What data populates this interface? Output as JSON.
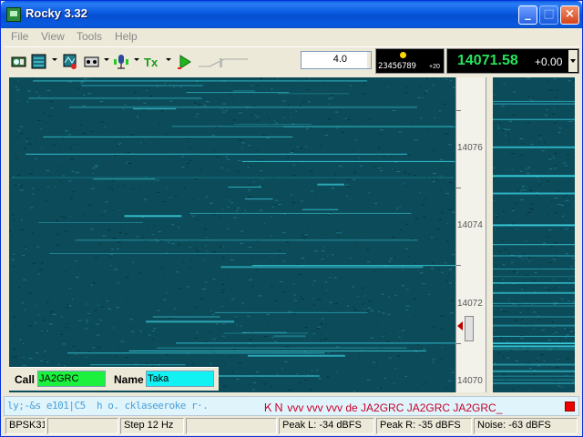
{
  "window": {
    "title": "Rocky 3.32"
  },
  "menu": [
    "File",
    "View",
    "Tools",
    "Help"
  ],
  "toolbar": {
    "zoom_value": "4.0",
    "level_digits": "23456789",
    "level_db": "+20",
    "frequency": "14071.58",
    "offset": "+0.00"
  },
  "scale": {
    "labels": [
      "14076",
      "14074",
      "14072",
      "14070"
    ]
  },
  "call_panel": {
    "call_label": "Call",
    "call_value": "JA2GRC",
    "name_label": "Name",
    "name_value": "Taka"
  },
  "rx": {
    "decoded": "ly;-&s e101|C5  h o. cklaseeroke r·.",
    "transmit": "ＫＮ vvv vvv vvv de JA2GRC JA2GRC JA2GRC_"
  },
  "status": {
    "mode": "BPSK31",
    "step": "Step 12 Hz",
    "peak_l": "Peak L: -34 dBFS",
    "peak_r": "Peak R: -35 dBFS",
    "noise": "Noise: -63 dBFS"
  },
  "colors": {
    "waterfall_bg": "#0c4c5a",
    "trace": "#3fe0f0",
    "call_field": "#1cf23e",
    "name_field": "#12f2f2",
    "frequency": "#27e35c",
    "tx_text": "#c8002a",
    "rx_text": "#4a9fd8"
  },
  "icons": [
    "app-icon",
    "macro-icon",
    "waterfall-icon",
    "afc-icon",
    "tape-icon",
    "mic-icon",
    "tx-icon",
    "play-icon",
    "squelch-icon"
  ]
}
